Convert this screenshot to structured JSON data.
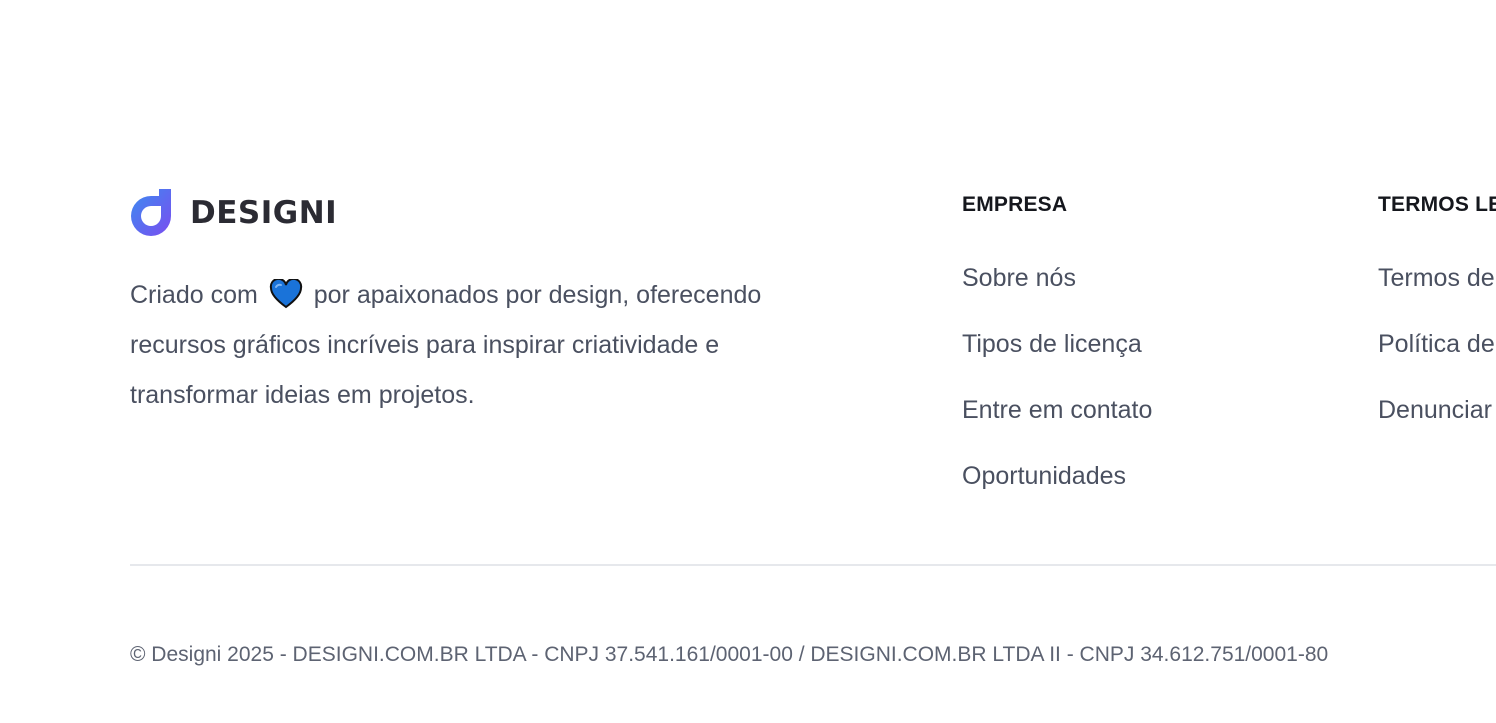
{
  "brand": {
    "name": "DESIGNI"
  },
  "about": {
    "text_before_heart": "Criado com",
    "heart_icon": "blue-heart-icon",
    "text_after_heart": "por apaixonados por design, oferecendo recursos gráficos incríveis para inspirar criatividade e transformar ideias em projetos."
  },
  "columns": {
    "empresa": {
      "heading": "EMPRESA",
      "links": [
        "Sobre nós",
        "Tipos de licença",
        "Entre em contato",
        "Oportunidades"
      ]
    },
    "termos": {
      "heading": "TERMOS LE",
      "links": [
        "Termos de",
        "Política de",
        "Denunciar"
      ]
    }
  },
  "copyright": "© Designi 2025 - DESIGNI.COM.BR LTDA - CNPJ 37.541.161/0001-00 / DESIGNI.COM.BR LTDA II - CNPJ 34.612.751/0001-80",
  "colors": {
    "logo_gradient_start": "#3b8cf0",
    "logo_gradient_end": "#7a4df0",
    "heart": "#1a73d9",
    "text": "#4a5060",
    "heading": "#15171d",
    "divider": "#e6e8ec"
  }
}
